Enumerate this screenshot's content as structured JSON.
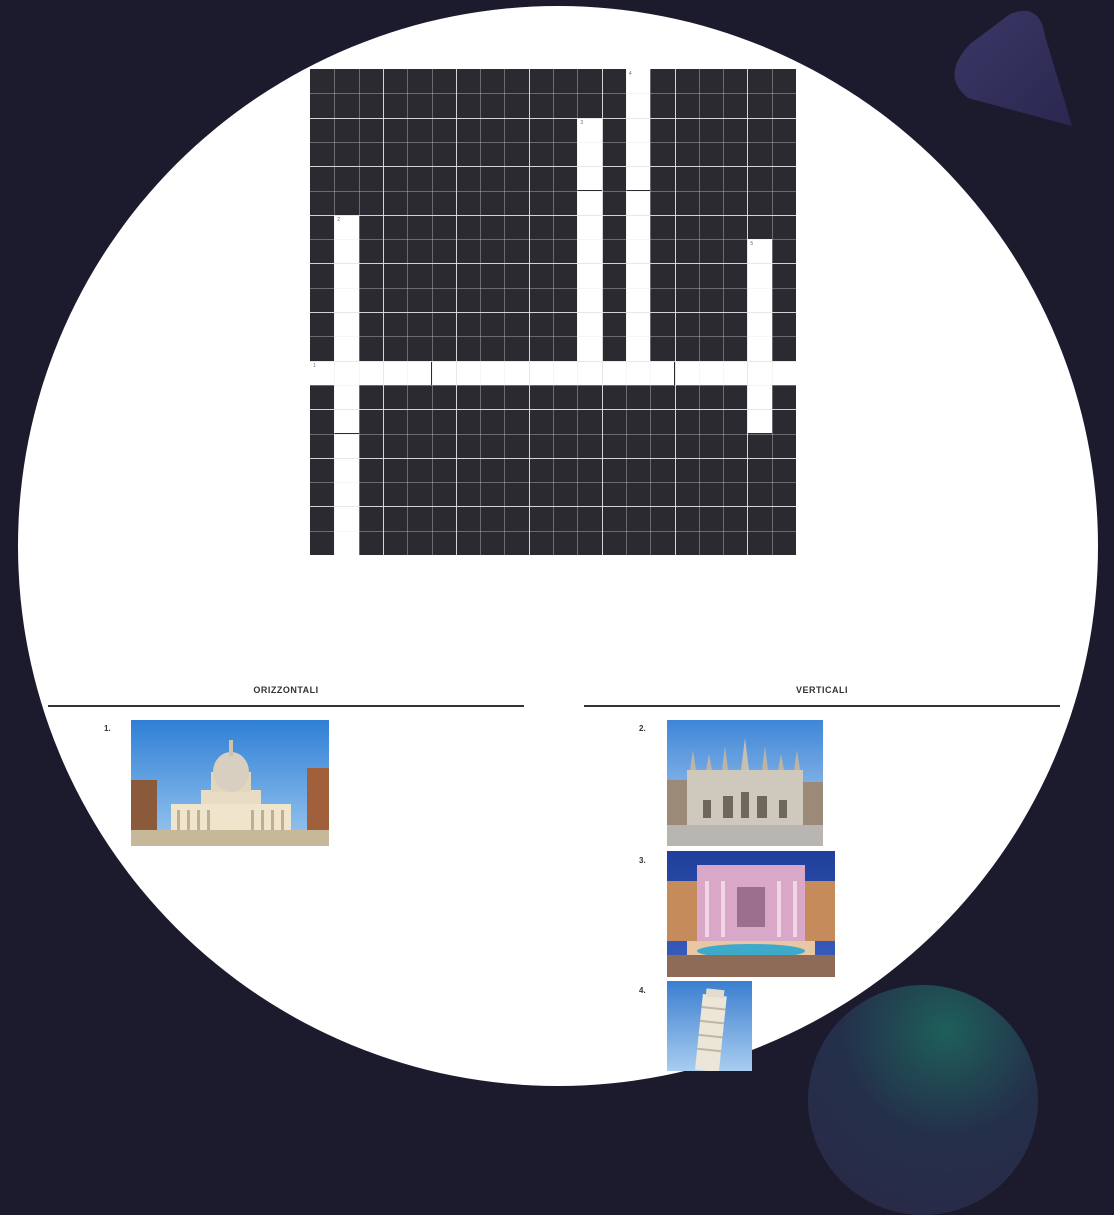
{
  "sections": {
    "horizontal_title": "ORIZZONTALI",
    "vertical_title": "VERTICALI"
  },
  "clues": {
    "across": [
      {
        "number": "1.",
        "image": "st-peters-basilica-photo"
      }
    ],
    "down": [
      {
        "number": "2.",
        "image": "milan-cathedral-photo"
      },
      {
        "number": "3.",
        "image": "trevi-fountain-photo"
      },
      {
        "number": "4.",
        "image": "leaning-tower-of-pisa-photo"
      }
    ]
  },
  "grid": {
    "rows": 20,
    "cols": 20,
    "words": [
      {
        "number": "1",
        "direction": "across",
        "row": 12,
        "col": 0,
        "length": 20
      },
      {
        "number": "2",
        "direction": "down",
        "row": 6,
        "col": 1,
        "length": 14
      },
      {
        "number": "3",
        "direction": "down",
        "row": 2,
        "col": 11,
        "length": 10
      },
      {
        "number": "4",
        "direction": "down",
        "row": 0,
        "col": 13,
        "length": 12
      },
      {
        "number": "5",
        "direction": "down",
        "row": 7,
        "col": 18,
        "length": 8
      }
    ]
  },
  "colors": {
    "background": "#1c1b2e",
    "page": "#ffffff",
    "grid_block": "#2a2a30",
    "grid_line": "#e6e6e6"
  }
}
